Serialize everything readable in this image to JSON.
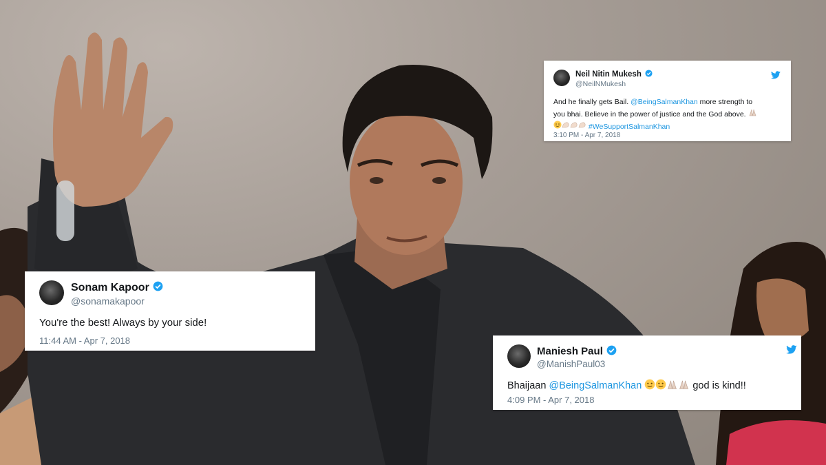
{
  "tweets": {
    "neil": {
      "name": "Neil Nitin Mukesh",
      "handle": "@NeilNMukesh",
      "line1_text": "And he finally gets Bail. ",
      "line1_mention": "@BeingSalmanKhan",
      "line1_rest": " more strength to",
      "line2_text": "you bhai. Believe in the power of justice and the God above. ",
      "line3_hashtag": "#WeSupportSalmanKhan",
      "time": "3:10 PM - Apr 7, 2018"
    },
    "sonam": {
      "name": "Sonam Kapoor",
      "handle": "@sonamakapoor",
      "text": "You're the best! Always by your side!",
      "time": "11:44 AM - Apr 7, 2018"
    },
    "maniesh": {
      "name": "Maniesh Paul",
      "handle": "@ManishPaul03",
      "text_before": "Bhaijaan ",
      "mention": "@BeingSalmanKhan",
      "text_after": " god is kind!!",
      "time": "4:09 PM - Apr 7, 2018"
    }
  },
  "colors": {
    "verified": "#1da1f2",
    "link": "#1b95e0",
    "twitter_bird": "#1da1f2",
    "meta_text": "#657786"
  },
  "icons": {
    "verified": "verified-badge-icon",
    "bird": "twitter-bird-icon",
    "hug": "hugging-face-emoji",
    "pray": "folded-hands-emoji",
    "flex": "flexed-biceps-emoji"
  }
}
